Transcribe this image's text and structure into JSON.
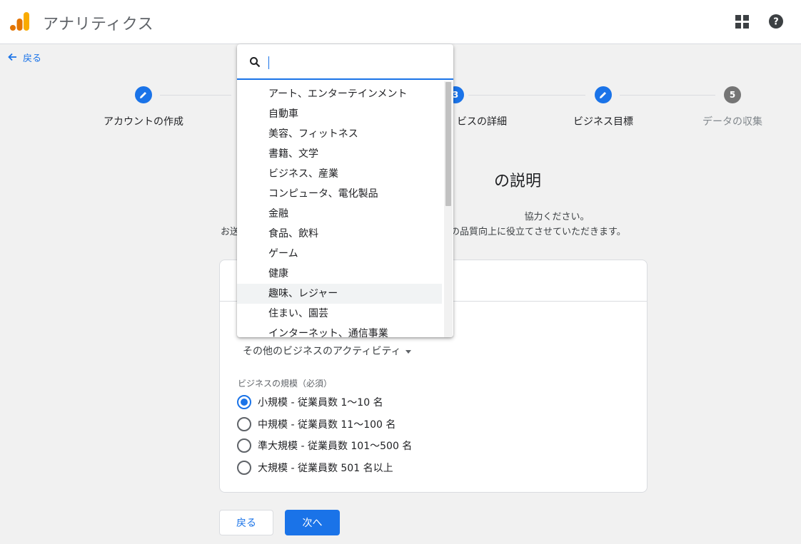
{
  "app": {
    "title": "アナリティクス"
  },
  "nav": {
    "back_label": "戻る"
  },
  "stepper": {
    "steps": [
      {
        "number": "",
        "label": "アカウントの作成",
        "state": "edit"
      },
      {
        "number": "3",
        "label": "ビスの詳細",
        "state": "current"
      },
      {
        "number": "",
        "label": "ビジネス目標",
        "state": "edit"
      },
      {
        "number": "5",
        "label": "データの収集",
        "state": "upcoming"
      }
    ]
  },
  "page": {
    "heading": "の説明",
    "description_line1": "協力ください。",
    "description_line2_left": "お送",
    "description_line2_right": "の品質向上に役立てさせていただきます。"
  },
  "form": {
    "category_value": "その他のビジネスのアクティビティ",
    "size_label": "ビジネスの規模（必須）",
    "size_options": [
      {
        "label": "小規模 - 従業員数 1〜10 名",
        "checked": true
      },
      {
        "label": "中規模 - 従業員数 11〜100 名",
        "checked": false
      },
      {
        "label": "準大規模 - 従業員数 101〜500 名",
        "checked": false
      },
      {
        "label": "大規模 - 従業員数 501 名以上",
        "checked": false
      }
    ]
  },
  "buttons": {
    "back": "戻る",
    "next": "次へ"
  },
  "dropdown": {
    "search_value": "",
    "items": [
      "アート、エンターテインメント",
      "自動車",
      "美容、フィットネス",
      "書籍、文学",
      "ビジネス、産業",
      "コンピュータ、電化製品",
      "金融",
      "食品、飲料",
      "ゲーム",
      "健康",
      "趣味、レジャー",
      "住まい、園芸",
      "インターネット、通信事業"
    ],
    "hovered_index": 10
  },
  "colors": {
    "accent": "#1a73e8",
    "logo_orange": "#f9ab00",
    "logo_dark_orange": "#e37400"
  }
}
